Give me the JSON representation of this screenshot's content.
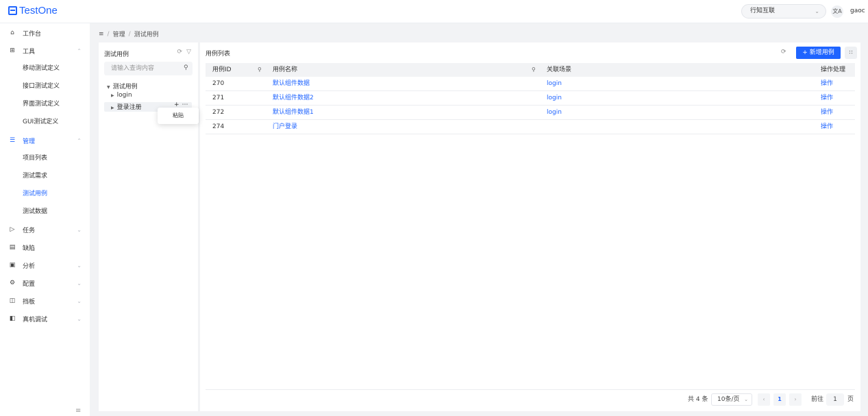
{
  "app": {
    "logo_text": "TestOne",
    "project": "行知互联",
    "translate_icon": "文A",
    "user": "gaoc"
  },
  "sidebar": {
    "items": [
      {
        "label": "工作台",
        "icon": "home-icon"
      },
      {
        "label": "工具",
        "icon": "apps-icon"
      },
      {
        "label": "移动测试定义"
      },
      {
        "label": "接口测试定义"
      },
      {
        "label": "界面测试定义"
      },
      {
        "label": "GUI测试定义"
      },
      {
        "label": "管理",
        "icon": "list-icon"
      },
      {
        "label": "项目列表"
      },
      {
        "label": "测试需求"
      },
      {
        "label": "测试用例"
      },
      {
        "label": "测试数据"
      },
      {
        "label": "任务",
        "icon": "send-icon"
      },
      {
        "label": "缺陷",
        "icon": "file-icon"
      },
      {
        "label": "分析",
        "icon": "calendar-icon"
      },
      {
        "label": "配置",
        "icon": "gear-icon"
      },
      {
        "label": "挡板",
        "icon": "panel-icon"
      },
      {
        "label": "真机调试",
        "icon": "device-icon"
      }
    ]
  },
  "breadcrumb": [
    "管理",
    "测试用例"
  ],
  "tree": {
    "title": "测试用例",
    "search_placeholder": "请输入查询内容",
    "nodes": [
      "测试用例",
      "login",
      "登录注册"
    ],
    "context_menu": "粘贴"
  },
  "main": {
    "title": "用例列表",
    "add_button": "+ 新增用例",
    "columns": [
      "用例ID",
      "用例名称",
      "关联场景",
      "操作处理"
    ],
    "rows": [
      {
        "id": "270",
        "name": "默认组件数据",
        "scene": "login",
        "action": "操作"
      },
      {
        "id": "271",
        "name": "默认组件数据2",
        "scene": "login",
        "action": "操作"
      },
      {
        "id": "272",
        "name": "默认组件数据1",
        "scene": "login",
        "action": "操作"
      },
      {
        "id": "274",
        "name": "门户登录",
        "scene": "",
        "action": "操作"
      }
    ],
    "pagination": {
      "total": "共 4 条",
      "page_size": "10条/页",
      "current_page": "1",
      "goto_label": "前往",
      "goto_value": "1",
      "page_unit": "页"
    }
  },
  "colors": {
    "accent": "#1f64ff",
    "background": "#f2f3f5"
  }
}
